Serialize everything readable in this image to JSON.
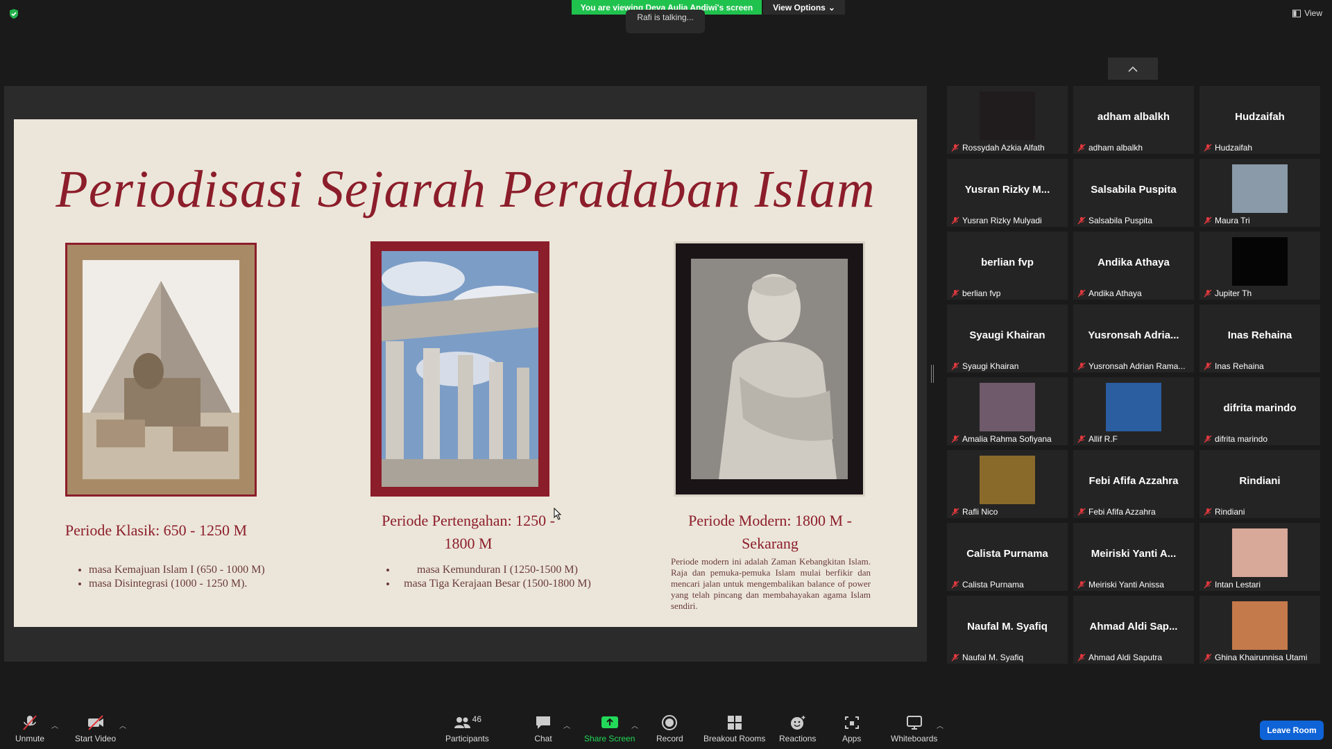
{
  "banner": {
    "viewing": "You are viewing Deva Aulia Andiwi's screen",
    "view_options": "View Options",
    "talking": "Rafi is talking...",
    "view": "View"
  },
  "slide": {
    "title": "Periodisasi Sejarah Peradaban Islam",
    "p1_title": "Periode Klasik: 650 - 1250 M",
    "p1_bullets": [
      "masa Kemajuan Islam I (650 - 1000 M)",
      "masa Disintegrasi (1000 - 1250 M)."
    ],
    "p2_title_line1": "Periode Pertengahan: 1250 -",
    "p2_title_line2": "1800 M",
    "p2_bullets": [
      "masa Kemunduran I (1250-1500 M)",
      "masa Tiga Kerajaan Besar (1500-1800 M)"
    ],
    "p3_title_line1": "Periode Modern: 1800 M -",
    "p3_title_line2": "Sekarang",
    "p3_text": "Periode modern ini adalah Zaman Kebangkitan Islam. Raja dan pemuka-pemuka Islam mulai berfikir dan mencari jalan untuk mengembalikan balance of power yang telah pincang dan membahayakan agama Islam sendiri."
  },
  "participants": [
    {
      "name": "Rossydah Azkia Alfath",
      "display": "",
      "photo": "#201c1e"
    },
    {
      "name": "adham albalkh",
      "display": "adham albalkh"
    },
    {
      "name": "Hudzaifah",
      "display": "Hudzaifah"
    },
    {
      "name": "Yusran Rizky Mulyadi",
      "display": "Yusran Rizky M..."
    },
    {
      "name": "Salsabila Puspita",
      "display": "Salsabila Puspita"
    },
    {
      "name": "Maura Tri",
      "display": "",
      "photo": "#8a9aa8"
    },
    {
      "name": "berlian fvp",
      "display": "berlian fvp"
    },
    {
      "name": "Andika Athaya",
      "display": "Andika Athaya"
    },
    {
      "name": "Jupiter Th",
      "display": "",
      "photo": "#050505"
    },
    {
      "name": "Syaugi Khairan",
      "display": "Syaugi Khairan"
    },
    {
      "name": "Yusronsah Adrian Rama...",
      "display": "Yusronsah Adria..."
    },
    {
      "name": "Inas Rehaina",
      "display": "Inas Rehaina"
    },
    {
      "name": "Amalia Rahma Sofiyana",
      "display": "",
      "photo": "#6e5a6a"
    },
    {
      "name": "Allif R.F",
      "display": "",
      "photo": "#2a5ea0"
    },
    {
      "name": "difrita marindo",
      "display": "difrita marindo"
    },
    {
      "name": "Rafli Nico",
      "display": "",
      "photo": "#8a6a2a"
    },
    {
      "name": "Febi Afifa Azzahra",
      "display": "Febi Afifa Azzahra"
    },
    {
      "name": "Rindiani",
      "display": "Rindiani"
    },
    {
      "name": "Calista Purnama",
      "display": "Calista Purnama"
    },
    {
      "name": "Meiriski Yanti Anissa",
      "display": "Meiriski Yanti A..."
    },
    {
      "name": "Intan Lestari",
      "display": "",
      "photo": "#d8a898"
    },
    {
      "name": "Naufal M. Syafiq",
      "display": "Naufal M. Syafiq"
    },
    {
      "name": "Ahmad Aldi Saputra",
      "display": "Ahmad Aldi Sap..."
    },
    {
      "name": "Ghina Khairunnisa Utami",
      "display": "",
      "photo": "#c47a4a"
    }
  ],
  "toolbar": {
    "unmute": "Unmute",
    "start_video": "Start Video",
    "participants": "Participants",
    "participants_count": "46",
    "chat": "Chat",
    "share_screen": "Share Screen",
    "record": "Record",
    "breakout": "Breakout Rooms",
    "reactions": "Reactions",
    "apps": "Apps",
    "whiteboards": "Whiteboards",
    "leave": "Leave Room"
  },
  "colors": {
    "share_green": "#23d959",
    "accent_maroon": "#8c1d2a",
    "mute_red": "#e0393e",
    "leave_blue": "#0e63d6"
  }
}
